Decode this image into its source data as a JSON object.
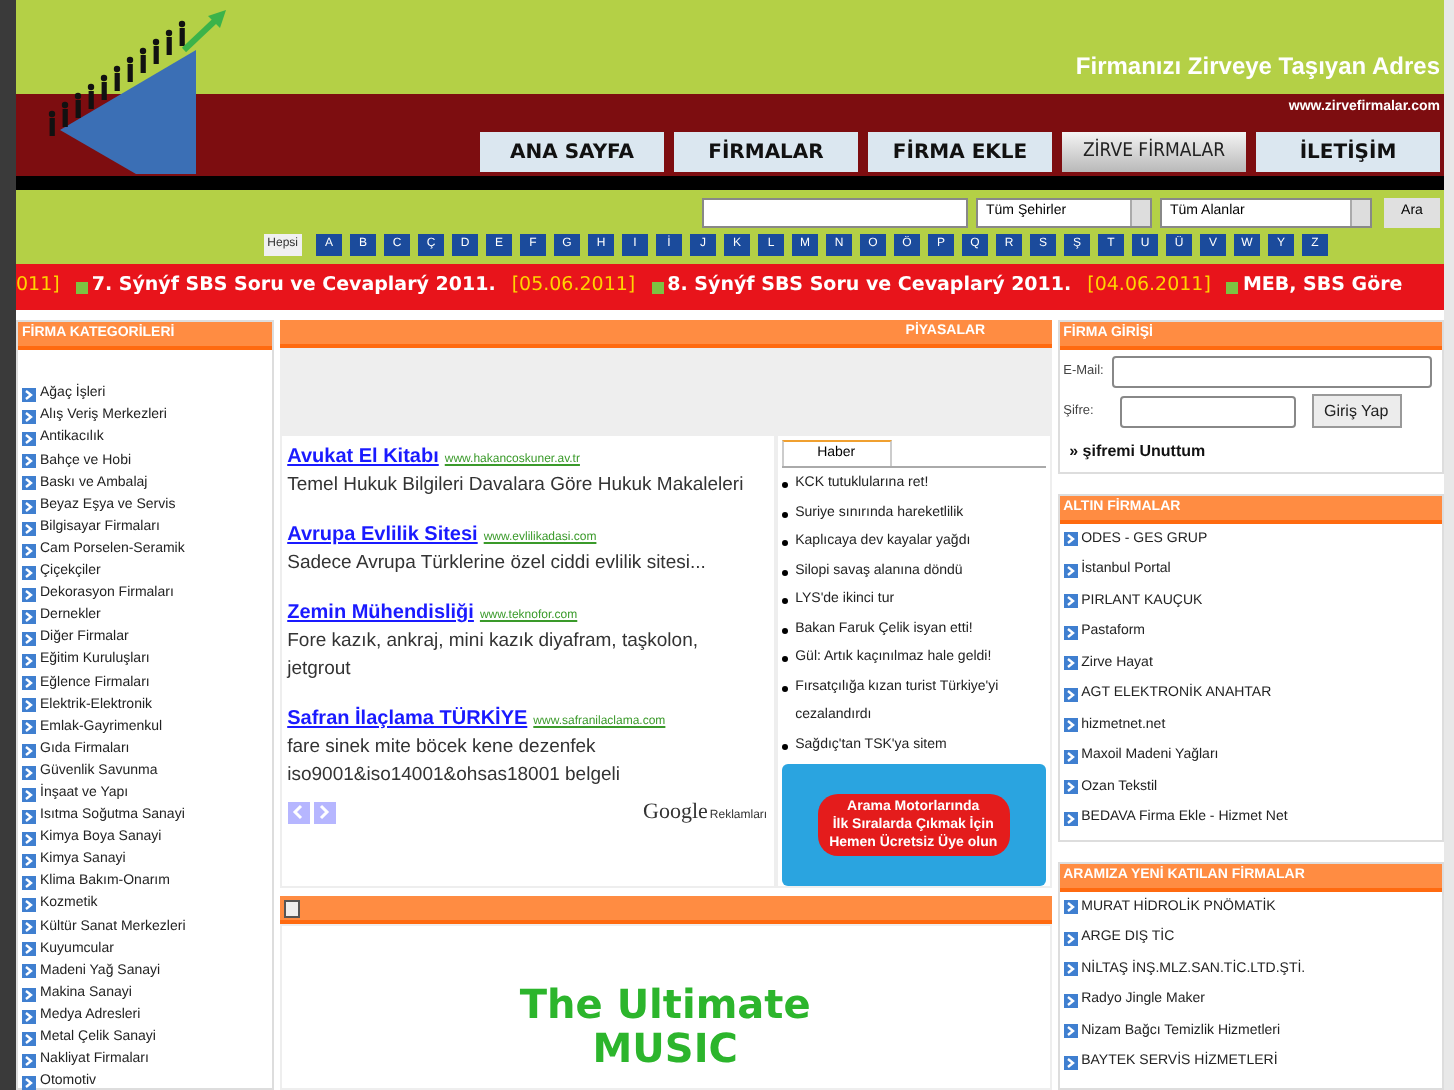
{
  "header": {
    "slogan": "Firmanızı Zirveye Taşıyan Adres",
    "site_url": "www.zirvefirmalar.com"
  },
  "nav": [
    {
      "label": "ANA SAYFA",
      "selected": false
    },
    {
      "label": "FİRMALAR",
      "selected": false
    },
    {
      "label": "FİRMA EKLE",
      "selected": false
    },
    {
      "label": "ZİRVE FİRMALAR",
      "selected": true
    },
    {
      "label": "İLETİŞİM",
      "selected": false
    }
  ],
  "search": {
    "city": "Tüm Şehirler",
    "field": "Tüm Alanlar",
    "button": "Ara"
  },
  "letters": [
    {
      "label": "Hepsi",
      "selected": true
    },
    {
      "label": "A",
      "selected": false
    },
    {
      "label": "B",
      "selected": false
    },
    {
      "label": "C",
      "selected": false
    },
    {
      "label": "Ç",
      "selected": false
    },
    {
      "label": "D",
      "selected": false
    },
    {
      "label": "E",
      "selected": false
    },
    {
      "label": "F",
      "selected": false
    },
    {
      "label": "G",
      "selected": false
    },
    {
      "label": "H",
      "selected": false
    },
    {
      "label": "I",
      "selected": false
    },
    {
      "label": "İ",
      "selected": false
    },
    {
      "label": "J",
      "selected": false
    },
    {
      "label": "K",
      "selected": false
    },
    {
      "label": "L",
      "selected": false
    },
    {
      "label": "M",
      "selected": false
    },
    {
      "label": "N",
      "selected": false
    },
    {
      "label": "O",
      "selected": false
    },
    {
      "label": "Ö",
      "selected": false
    },
    {
      "label": "P",
      "selected": false
    },
    {
      "label": "Q",
      "selected": false
    },
    {
      "label": "R",
      "selected": false
    },
    {
      "label": "S",
      "selected": false
    },
    {
      "label": "Ş",
      "selected": false
    },
    {
      "label": "T",
      "selected": false
    },
    {
      "label": "U",
      "selected": false
    },
    {
      "label": "Ü",
      "selected": false
    },
    {
      "label": "V",
      "selected": false
    },
    {
      "label": "W",
      "selected": false
    },
    {
      "label": "Y",
      "selected": false
    },
    {
      "label": "Z",
      "selected": false
    }
  ],
  "ticker": {
    "lead": "011]",
    "items": [
      {
        "title": "7. Sýnýf SBS Soru ve Cevaplarý 2011.",
        "date": "[05.06.2011]"
      },
      {
        "title": "8. Sýnýf SBS Soru ve Cevaplarý 2011.",
        "date": "[04.06.2011]"
      },
      {
        "title": "MEB, SBS Göre"
      }
    ]
  },
  "categories": {
    "title": "FİRMA KATEGORİLERİ",
    "items": [
      "Ağaç İşleri",
      "Alış Veriş Merkezleri",
      "Antikacılık",
      "Bahçe ve Hobi",
      "Baskı ve Ambalaj",
      "Beyaz Eşya ve Servis",
      "Bilgisayar Firmaları",
      "Cam Porselen-Seramik",
      "Çiçekçiler",
      "Dekorasyon Firmaları",
      "Dernekler",
      "Diğer Firmalar",
      "Eğitim Kuruluşları",
      "Eğlence Firmaları",
      "Elektrik-Elektronik",
      "Emlak-Gayrimenkul",
      "Gıda Firmaları",
      "Güvenlik Savunma",
      "İnşaat ve Yapı",
      "Isıtma Soğutma Sanayi",
      "Kimya Boya Sanayi",
      "Kimya Sanayi",
      "Klima Bakım-Onarım",
      "Kozmetik",
      "Kültür Sanat Merkezleri",
      "Kuyumcular",
      "Madeni Yağ Sanayi",
      "Makina Sanayi",
      "Medya Adresleri",
      "Metal Çelik Sanayi",
      "Nakliyat Firmaları",
      "Otomotiv"
    ]
  },
  "market": {
    "title": "PİYASALAR"
  },
  "ads": {
    "items": [
      {
        "title": "Avukat El Kitabı",
        "url": "www.hakancoskuner.av.tr",
        "text": "Temel Hukuk Bilgileri Davalara Göre Hukuk Makaleleri"
      },
      {
        "title": "Avrupa Evlilik Sitesi",
        "url": "www.evlilikadasi.com",
        "text": "Sadece Avrupa Türklerine özel ciddi evlilik sitesi..."
      },
      {
        "title": "Zemin Mühendisliği",
        "url": "www.teknofor.com",
        "text": "Fore kazık, ankraj, mini kazık diyafram, taşkolon, jetgrout"
      },
      {
        "title": "Safran İlaçlama TÜRKİYE",
        "url": "www.safranilaclama.com",
        "text": "fare sinek mite böcek kene dezenfek iso9001&iso14001&ohsas18001 belgeli"
      }
    ],
    "brand": "Google",
    "brand_suffix": "Reklamları"
  },
  "news": {
    "tab": "Haber",
    "items": [
      "KCK tutuklularına ret!",
      "Suriye sınırında hareketlilik",
      "Kaplıcaya dev kayalar yağdı",
      "Silopi savaş alanına döndü",
      "LYS'de ikinci tur",
      "Bakan Faruk Çelik isyan etti!",
      "Gül: Artık kaçınılmaz hale geldi!",
      "Fırsatçılığa kızan turist Türkiye'yi cezalandırdı",
      "Sağdıç'tan TSK'ya sitem"
    ],
    "banner": [
      "Arama Motorlarında",
      "İlk Sıralarda Çıkmak İçin",
      "Hemen Ücretsiz Üye olun"
    ]
  },
  "promo": {
    "lines": [
      "The Ultimate",
      "MUSIC"
    ]
  },
  "login": {
    "title": "FİRMA GİRİŞİ",
    "email_label": "E-Mail:",
    "password_label": "Şifre:",
    "button": "Giriş Yap",
    "forgot": "» şifremi Unuttum"
  },
  "gold": {
    "title": "ALTIN FİRMALAR",
    "items": [
      "ODES - GES GRUP",
      "İstanbul Portal",
      "PIRLANT KAUÇUK",
      "Pastaform",
      "Zirve Hayat",
      "AGT ELEKTRONİK ANAHTAR",
      "hizmetnet.net",
      "Maxoil Madeni Yağları",
      "Ozan Tekstil",
      "BEDAVA Firma Ekle - Hizmet Net"
    ]
  },
  "newest": {
    "title": "ARAMIZA YENİ KATILAN FİRMALAR",
    "items": [
      "MURAT HİDROLİK PNÖMATİK",
      "ARGE DIŞ TİC",
      "NİLTAŞ İNŞ.MLZ.SAN.TİC.LTD.ŞTİ.",
      "Radyo Jingle Maker",
      "Nizam Bağcı Temizlik Hizmetleri",
      "BAYTEK SERVİS HİZMETLERİ"
    ]
  }
}
